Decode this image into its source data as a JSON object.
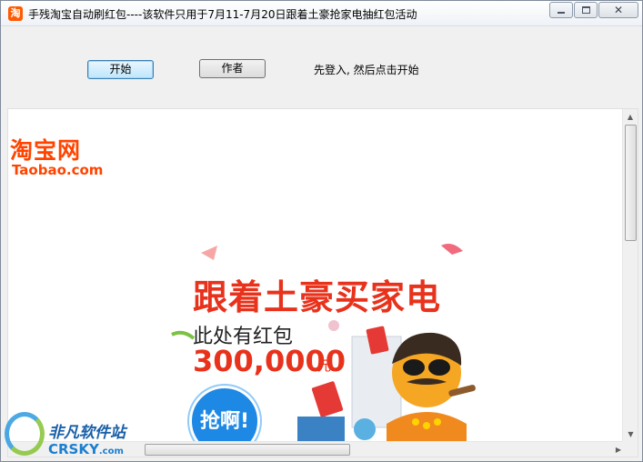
{
  "window": {
    "app_icon_glyph": "淘",
    "title": "手残淘宝自动刷红包----该软件只用于7月11-7月20日跟着土豪抢家电抽红包活动"
  },
  "toolbar": {
    "start_label": "开始",
    "author_label": "作者",
    "hint": "先登入, 然后点击开始"
  },
  "banner": {
    "logo_cn": "淘宝网",
    "logo_en": "Taobao.com",
    "headline": "跟着土豪买家电",
    "subline": "此处有红包",
    "amount": "300,0000",
    "amount_unit": "元",
    "grab_label": "抢啊!"
  },
  "watermark": {
    "site_cn": "非凡软件站",
    "site_en": "CRSKY",
    "site_en_suffix": ".com"
  },
  "colors": {
    "accent_orange": "#ff4400",
    "headline_red": "#e8321c",
    "button_blue": "#1e88e5"
  }
}
